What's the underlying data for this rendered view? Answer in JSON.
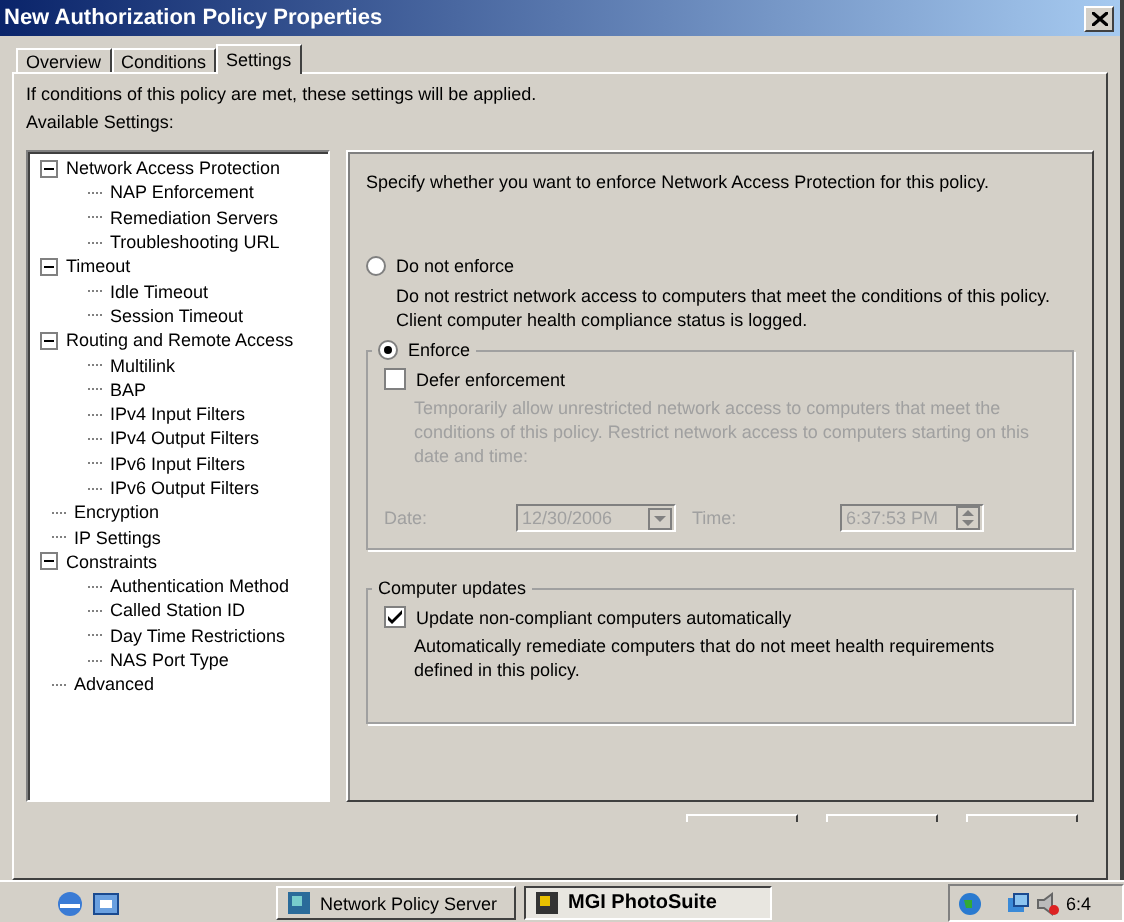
{
  "window": {
    "title": "New Authorization Policy Properties"
  },
  "tabs": [
    {
      "label": "Overview",
      "selected": false
    },
    {
      "label": "Conditions",
      "selected": false
    },
    {
      "label": "Settings",
      "selected": true
    }
  ],
  "intro": "If conditions of this policy are met, these settings will be applied.",
  "available_label": "Available Settings:",
  "tree": [
    {
      "label": "Network Access Protection",
      "expanded": true,
      "children": [
        {
          "label": "NAP Enforcement"
        },
        {
          "label": "Remediation Servers"
        },
        {
          "label": "Troubleshooting URL"
        }
      ]
    },
    {
      "label": "Timeout",
      "expanded": true,
      "children": [
        {
          "label": "Idle Timeout"
        },
        {
          "label": "Session Timeout"
        }
      ]
    },
    {
      "label": "Routing and Remote Access",
      "expanded": true,
      "children": [
        {
          "label": "Multilink"
        },
        {
          "label": "BAP"
        },
        {
          "label": "IPv4 Input Filters"
        },
        {
          "label": "IPv4 Output Filters"
        },
        {
          "label": "IPv6 Input Filters"
        },
        {
          "label": "IPv6 Output Filters"
        }
      ]
    },
    {
      "label": "Encryption"
    },
    {
      "label": "IP Settings"
    },
    {
      "label": "Constraints",
      "expanded": true,
      "children": [
        {
          "label": "Authentication Method"
        },
        {
          "label": "Called Station ID"
        },
        {
          "label": "Day Time Restrictions"
        },
        {
          "label": "NAS Port Type"
        }
      ]
    },
    {
      "label": "Advanced"
    }
  ],
  "panel": {
    "heading": "Specify whether you want to enforce Network Access Protection for this policy.",
    "options": [
      {
        "label": "Do not enforce",
        "selected": false,
        "description": "Do not restrict network access to computers that meet the conditions of this policy. Client computer health compliance status is logged."
      },
      {
        "label": "Enforce",
        "selected": true
      }
    ],
    "defer": {
      "label": "Defer enforcement",
      "checked": false,
      "description": "Temporarily allow unrestricted network access to computers that meet the conditions of this policy. Restrict network access to computers starting on this date and time:",
      "date_label": "Date:",
      "date": "12/30/2006",
      "time_label": "Time:",
      "time": "6:37:53 PM"
    },
    "updates": {
      "title": "Computer updates",
      "label": "Update non-compliant computers automatically",
      "checked": true,
      "description": "Automatically remediate computers that do not meet health requirements defined in this policy."
    }
  },
  "taskbar": {
    "tasks": [
      {
        "label": "Network Policy Server",
        "selected": false
      },
      {
        "label": "MGI PhotoSuite",
        "selected": true
      }
    ],
    "clock": "6:4"
  }
}
